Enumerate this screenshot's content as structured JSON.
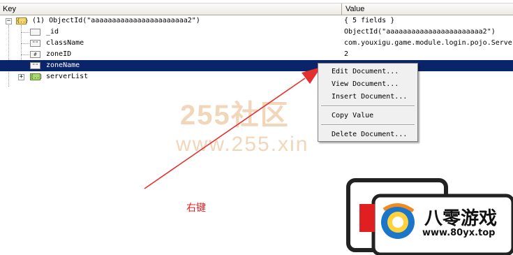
{
  "header": {
    "key_label": "Key",
    "value_label": "Value"
  },
  "rows": [
    {
      "key": "(1) ObjectId(\"aaaaaaaaaaaaaaaaaaaaaaa2\")",
      "value": "{ 5 fields }",
      "icon": "{..}"
    },
    {
      "key": "_id",
      "value": "ObjectId(\"aaaaaaaaaaaaaaaaaaaaaaa2\")",
      "icon": ""
    },
    {
      "key": "className",
      "value": "com.youxigu.game.module.login.pojo.Server",
      "icon": "\"\""
    },
    {
      "key": "zoneID",
      "value": "2",
      "icon": "#"
    },
    {
      "key": "zoneName",
      "value": "",
      "icon": "\"\""
    },
    {
      "key": "serverList",
      "value": "",
      "icon": "[..]"
    }
  ],
  "context_menu": {
    "items": [
      "Edit Document...",
      "View Document...",
      "Insert Document...",
      "Copy Value",
      "Delete Document..."
    ]
  },
  "annotation": {
    "caption": "右键",
    "arrow_color": "#e53030"
  },
  "watermarks": {
    "cn": "255社区",
    "url": "www.255.xin",
    "brand": "八零游戏",
    "brand_url": "www.80yx.top"
  },
  "colors": {
    "selection": "#0a246a",
    "caption": "#e02020",
    "watermark": "#e8b482"
  }
}
